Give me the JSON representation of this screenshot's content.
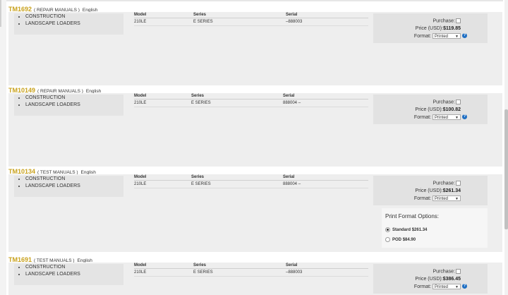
{
  "columns": {
    "model": "Model",
    "series": "Series",
    "serial": "Serial"
  },
  "labels": {
    "purchase": "Purchase:",
    "price": "Price (USD):",
    "format": "Format:",
    "help": "?"
  },
  "manuals": [
    {
      "number": "TM1692",
      "type": "( REPAIR MANUALS )",
      "language": "English",
      "categories": [
        "CONSTRUCTION",
        "LANDSCAPE LOADERS"
      ],
      "model": "210LE",
      "series": "E SERIES",
      "serial": "–888003",
      "price": "$119.85",
      "format": "Printed"
    },
    {
      "number": "TM10149",
      "type": "( REPAIR MANUALS )",
      "language": "English",
      "categories": [
        "CONSTRUCTION",
        "LANDSCAPE LOADERS"
      ],
      "model": "210LE",
      "series": "E SERIES",
      "serial": "888004 –",
      "price": "$100.82",
      "format": "Printed"
    },
    {
      "number": "TM10134",
      "type": "( TEST MANUALS )",
      "language": "English",
      "categories": [
        "CONSTRUCTION",
        "LANDSCAPE LOADERS"
      ],
      "model": "210LE",
      "series": "E SERIES",
      "serial": "888004 –",
      "price": "$261.34",
      "format": "Printed",
      "print_options": {
        "title": "Print Format Options:",
        "standard": {
          "label": "Standard",
          "price": "$261.34",
          "selected": true
        },
        "pod": {
          "label": "POD",
          "price": "$84.90",
          "selected": false
        }
      }
    },
    {
      "number": "TM1691",
      "type": "( TEST MANUALS )",
      "language": "English",
      "categories": [
        "CONSTRUCTION",
        "LANDSCAPE LOADERS"
      ],
      "model": "210LE",
      "series": "E SERIES",
      "serial": "–888003",
      "price": "$386.45",
      "format": "Printed"
    }
  ],
  "icons": {
    "help": "help-circle-icon",
    "radio": "radio-button-icon",
    "checkbox": "checkbox-icon"
  },
  "colors": {
    "manual_number": "#c8a11c",
    "help_icon": "#1f6fc3",
    "panel_bg": "#eeeeee"
  }
}
